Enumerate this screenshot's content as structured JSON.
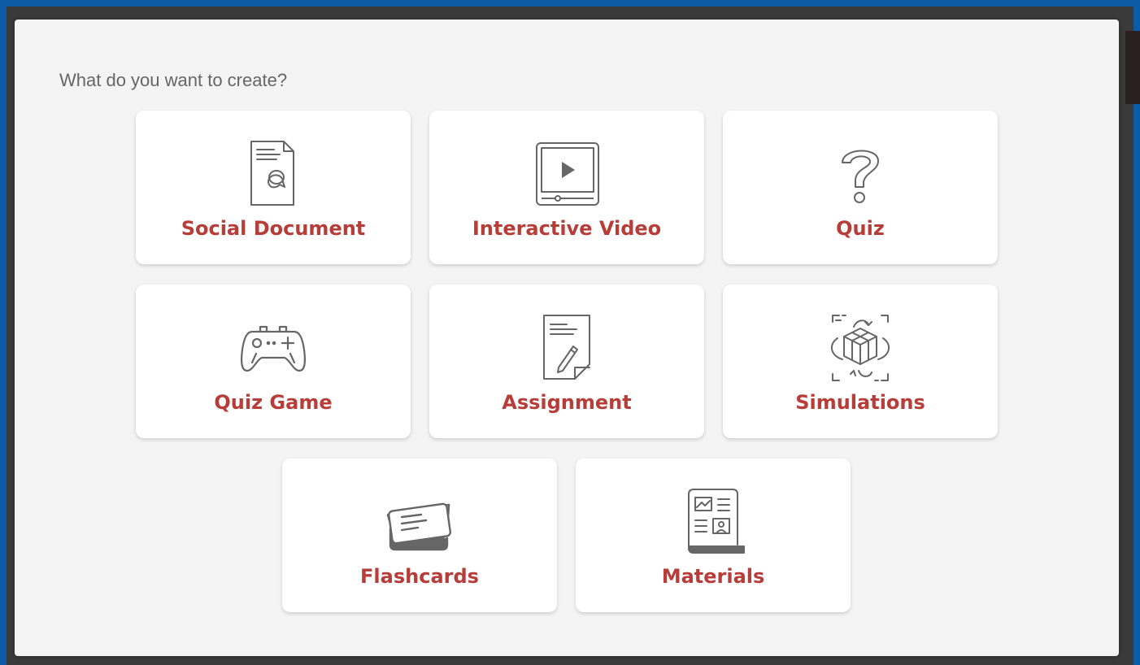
{
  "dialog": {
    "title": "What do you want to create?"
  },
  "options": [
    {
      "label": "Social Document",
      "icon": "social-document-icon"
    },
    {
      "label": "Interactive Video",
      "icon": "video-player-icon"
    },
    {
      "label": "Quiz",
      "icon": "question-mark-icon"
    },
    {
      "label": "Quiz Game",
      "icon": "gamepad-icon"
    },
    {
      "label": "Assignment",
      "icon": "assignment-pencil-icon"
    },
    {
      "label": "Simulations",
      "icon": "3d-cube-rotate-icon"
    },
    {
      "label": "Flashcards",
      "icon": "flashcards-icon"
    },
    {
      "label": "Materials",
      "icon": "materials-book-icon"
    }
  ],
  "colors": {
    "accent": "#b83c38",
    "icon": "#666666",
    "modal_background": "#f4f4f4",
    "card_background": "#ffffff",
    "frame": "#0d5aa6"
  }
}
